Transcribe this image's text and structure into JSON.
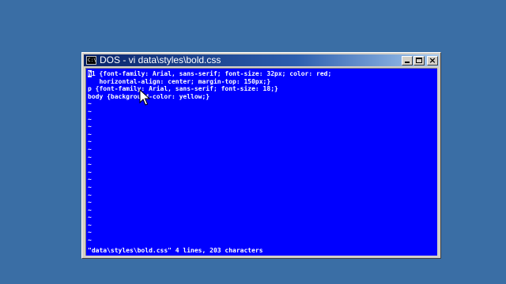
{
  "window": {
    "title": "DOS - vi data\\styles\\bold.css",
    "icon_text": "C:\\"
  },
  "editor": {
    "lines": [
      "h1 {font-family: Arial, sans-serif; font-size: 32px; color: red;",
      "   horizontal-align: center; margin-top: 150px;}",
      "p {font-family: Arial, sans-serif; font-size: 18;}",
      "body {background-color: yellow;}"
    ],
    "first_char": "h",
    "first_line_rest": "1 {font-family: Arial, sans-serif; font-size: 32px; color: red;",
    "tilde": "~",
    "status_line": "\"data\\styles\\bold.css\" 4 lines, 203 characters"
  },
  "colors": {
    "desktop": "#3a6ea5",
    "console_bg": "#0000ff",
    "console_fg": "#ffffff",
    "titlebar": "#0a246a"
  },
  "icons": [
    "dos-console-icon",
    "minimize-icon",
    "maximize-icon",
    "close-icon",
    "mouse-pointer-icon"
  ]
}
